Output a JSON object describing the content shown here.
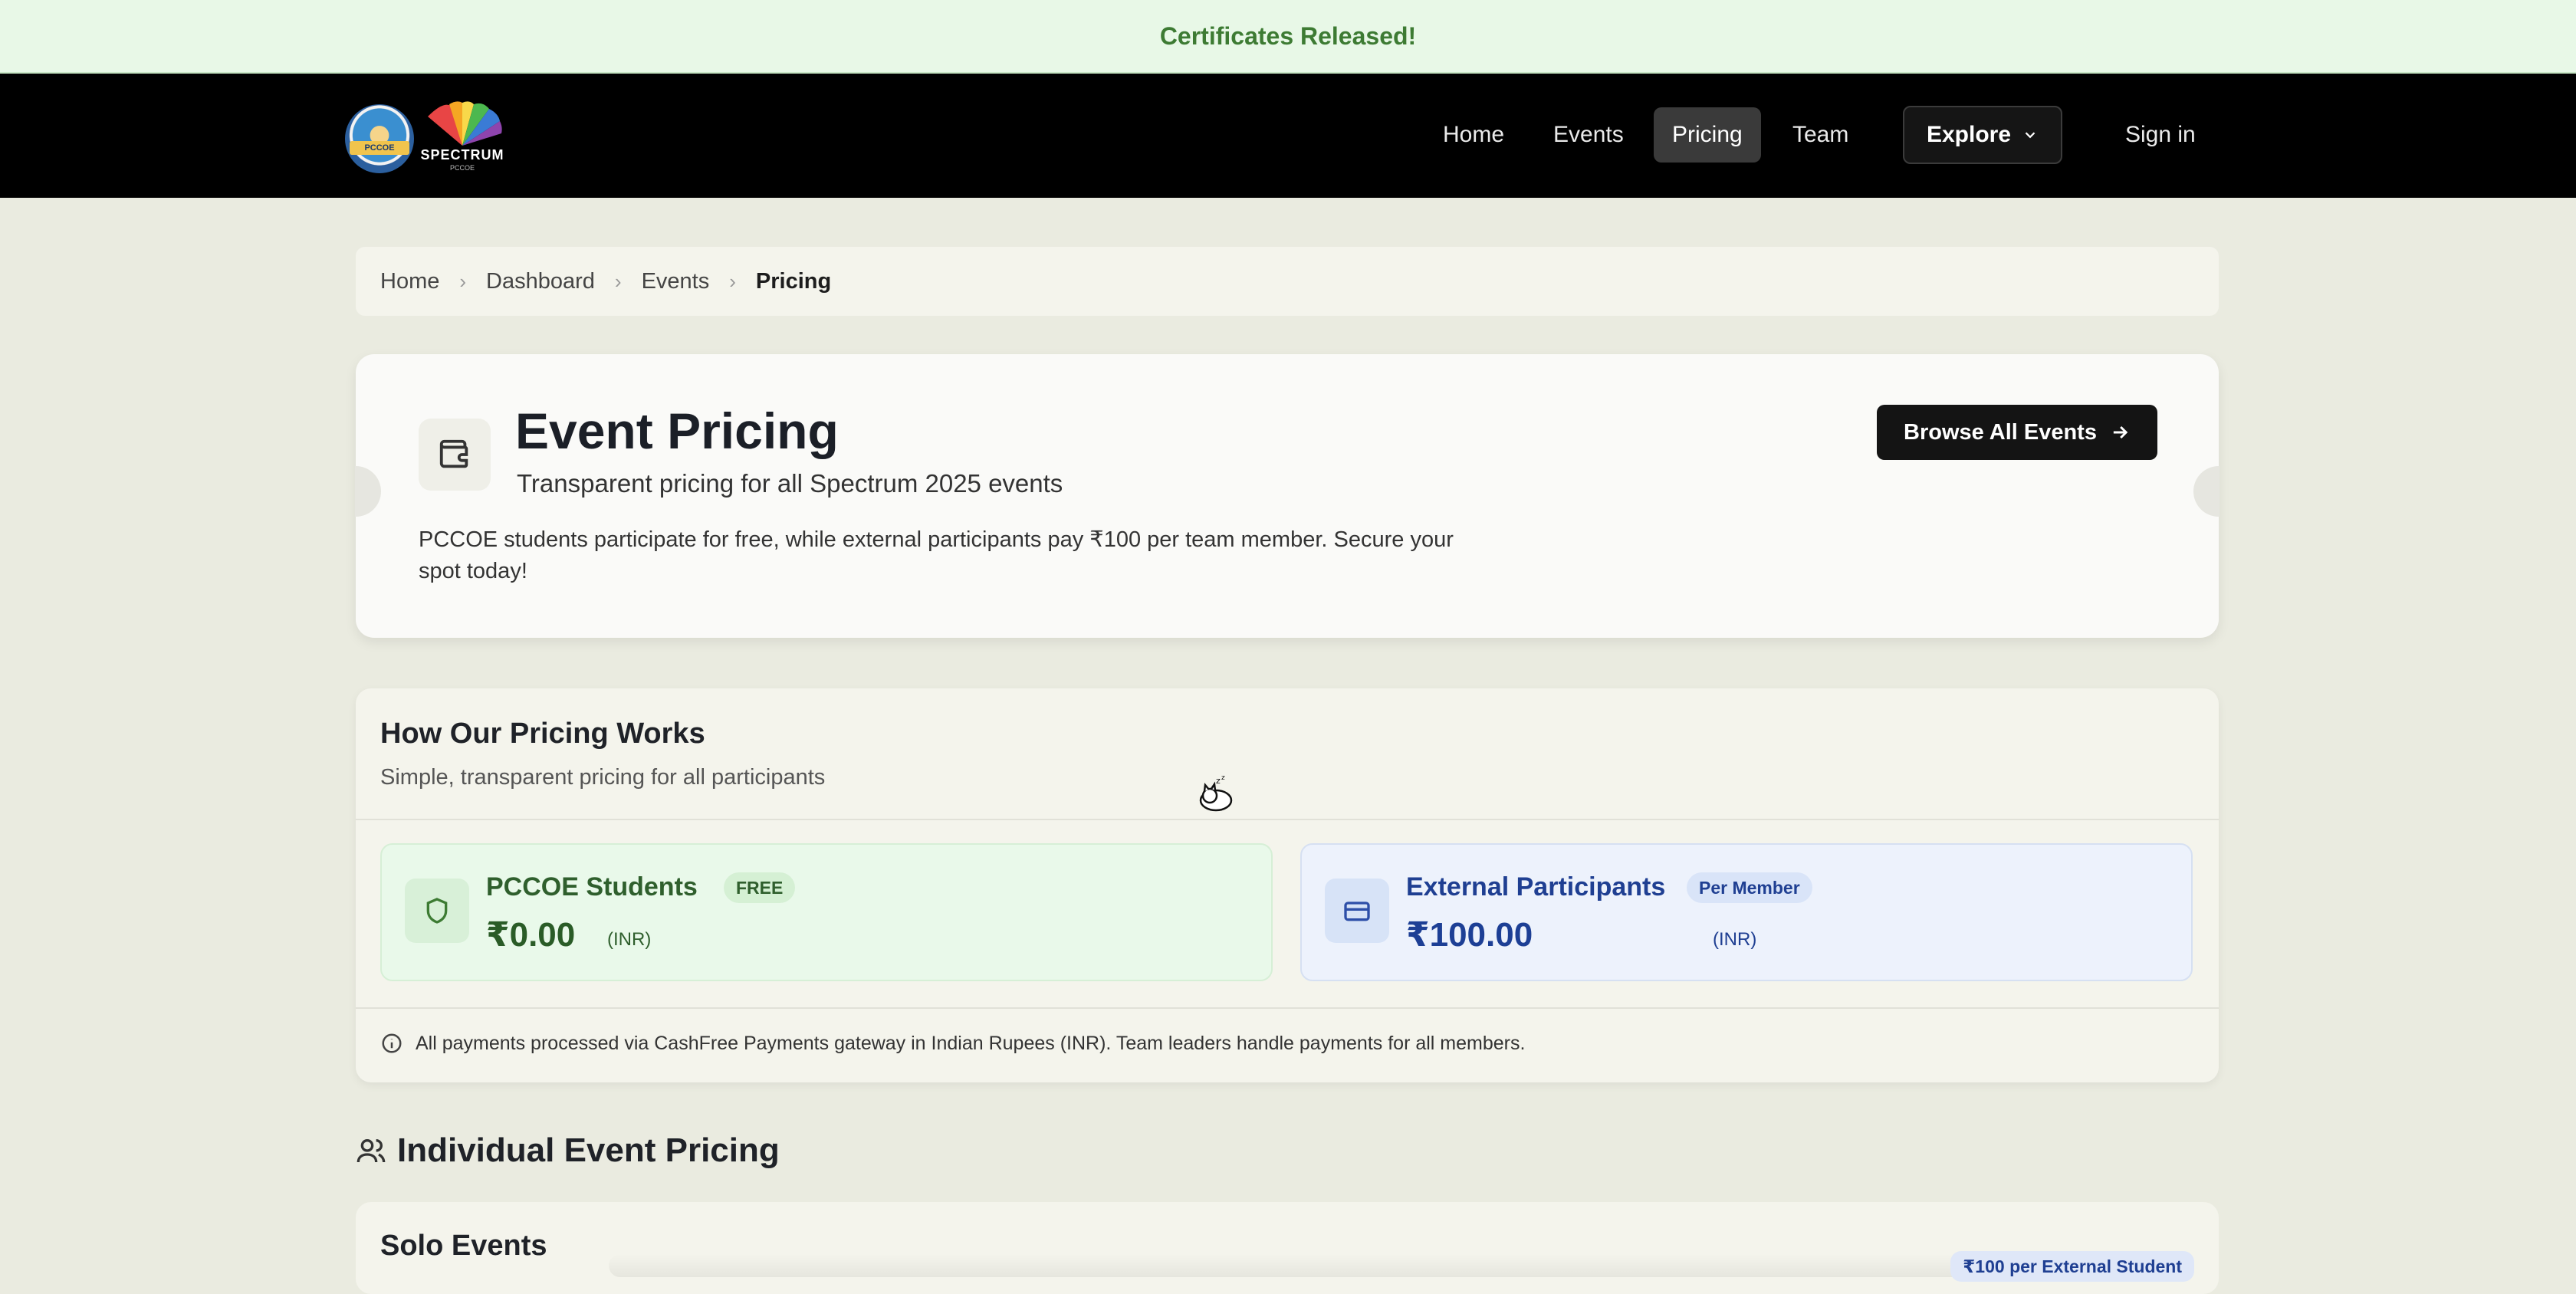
{
  "banner": {
    "text": "Certificates Released!"
  },
  "nav": {
    "links": [
      "Home",
      "Events",
      "Pricing",
      "Team"
    ],
    "active": "Pricing",
    "explore": "Explore",
    "signin": "Sign in",
    "logo": {
      "ribbon": "PCCOE",
      "word": "SPECTRUM",
      "sub": "PCCOE"
    }
  },
  "breadcrumb": [
    "Home",
    "Dashboard",
    "Events",
    "Pricing"
  ],
  "hero": {
    "title": "Event Pricing",
    "subtitle": "Transparent pricing for all Spectrum 2025 events",
    "description": "PCCOE students participate for free, while external participants pay ₹100 per team member. Secure your spot today!",
    "button": "Browse All Events",
    "icon": "wallet-icon"
  },
  "how": {
    "title": "How Our Pricing Works",
    "subtitle": "Simple, transparent pricing for all participants",
    "plans": [
      {
        "name": "PCCOE Students",
        "badge": "FREE",
        "price": "₹0.00",
        "currency": "(INR)",
        "icon": "shield-icon",
        "color": "#2f5f2d"
      },
      {
        "name": "External Participants",
        "badge": "Per Member",
        "price": "₹100.00",
        "currency": "(INR)",
        "icon": "credit-card-icon",
        "color": "#1f3f92"
      }
    ],
    "note": "All payments processed via CashFree Payments gateway in Indian Rupees (INR). Team leaders handle payments for all members."
  },
  "individual": {
    "title": "Individual Event Pricing",
    "icon": "users-icon"
  },
  "solo": {
    "title": "Solo Events",
    "tag": "₹100 per External Student"
  }
}
